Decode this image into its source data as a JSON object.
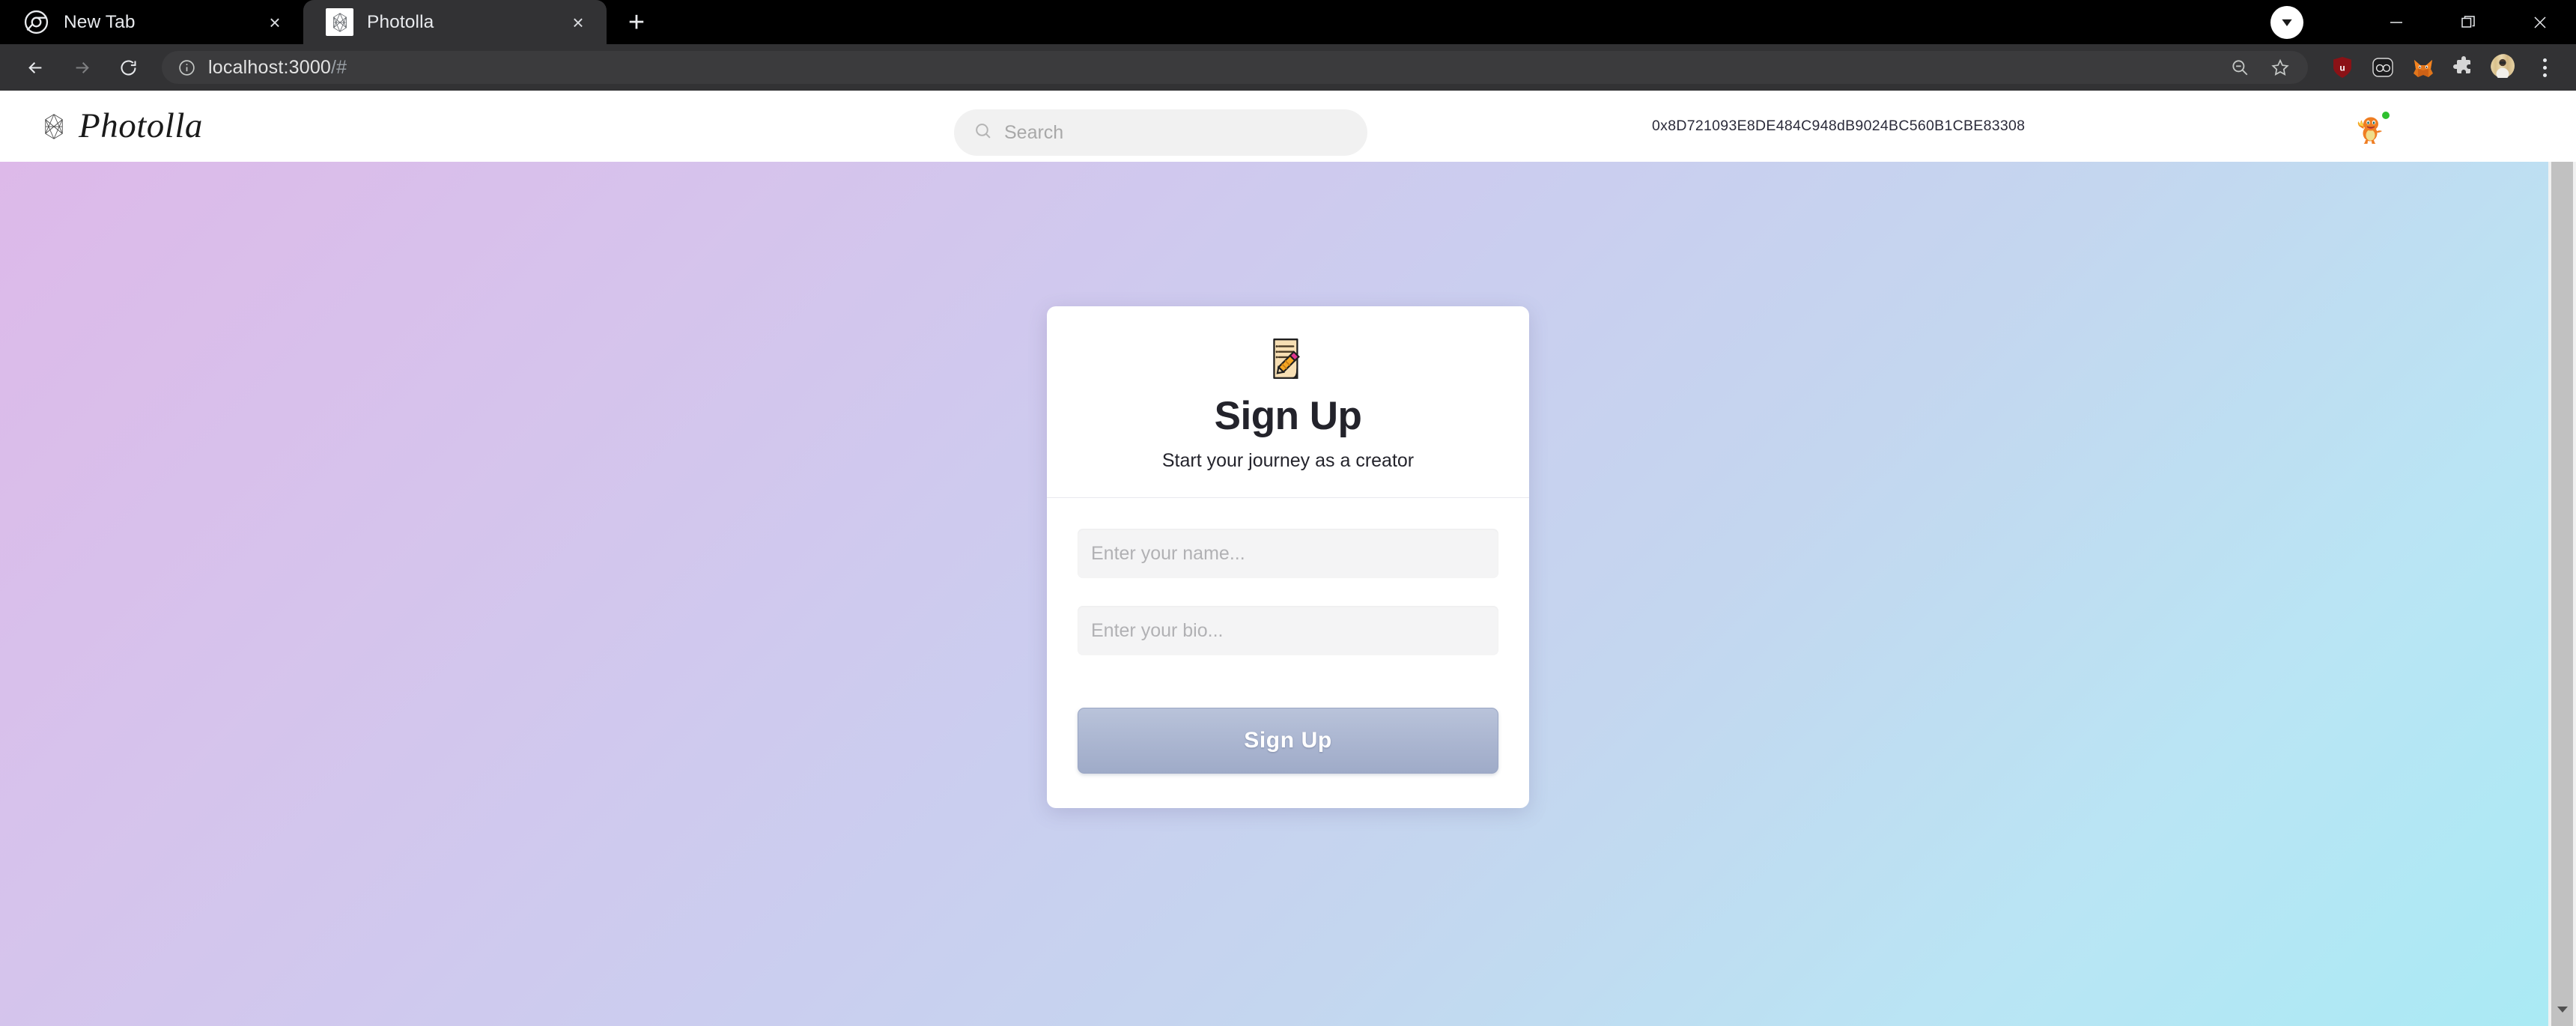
{
  "browser": {
    "tabs": [
      {
        "title": "New Tab",
        "favicon": "chrome-logo-icon",
        "active": false,
        "close_label": "×"
      },
      {
        "title": "Photolla",
        "favicon": "photolla-gem-icon",
        "active": true,
        "close_label": "×"
      }
    ],
    "new_tab_label": "+",
    "window_controls": {
      "download_icon": "download-caret-icon",
      "minimize_label": "—",
      "restore_label": "restore-icon",
      "close_label": "×"
    },
    "nav": {
      "back_icon": "arrow-left-icon",
      "forward_icon": "arrow-right-icon",
      "reload_icon": "reload-icon"
    },
    "omnibox": {
      "info_icon": "info-circle-icon",
      "url_host": "localhost:3000",
      "url_path": "/#",
      "zoom_out_icon": "zoom-out-icon",
      "bookmark_icon": "star-icon"
    },
    "extensions": [
      {
        "name": "ublock-origin-icon",
        "label": "uBlock Origin"
      },
      {
        "name": "pocket-icon",
        "label": "Pocket"
      },
      {
        "name": "metamask-fox-icon",
        "label": "MetaMask"
      },
      {
        "name": "extensions-puzzle-icon",
        "label": "Extensions"
      }
    ],
    "profile_avatar": "profile-avatar",
    "menu_icon": "three-dot-menu-icon"
  },
  "site": {
    "brand": {
      "name": "Photolla",
      "mark": "photolla-gem-icon"
    },
    "search": {
      "placeholder": "Search",
      "value": "",
      "icon": "search-icon"
    },
    "wallet_address": "0x8D721093E8DE484C948dB9024BC560B1CBE83308",
    "user_avatar": {
      "name": "charmander-avatar",
      "status": "online"
    }
  },
  "signup_card": {
    "emoji_icon": "memo-pencil-icon",
    "title": "Sign Up",
    "subtitle": "Start your journey as a creator",
    "fields": [
      {
        "name": "name-field",
        "placeholder": "Enter your name...",
        "value": ""
      },
      {
        "name": "bio-field",
        "placeholder": "Enter your bio...",
        "value": ""
      }
    ],
    "submit_label": "Sign Up"
  },
  "theme": {
    "gradient_start": "#ddb9e9",
    "gradient_end": "#a9eaf4",
    "button_blue": "#aab5d0",
    "status_green": "#2fc02f",
    "chrome_dark": "#323234"
  },
  "scrollbar": {
    "arrow_icon": "chevron-down-icon"
  }
}
